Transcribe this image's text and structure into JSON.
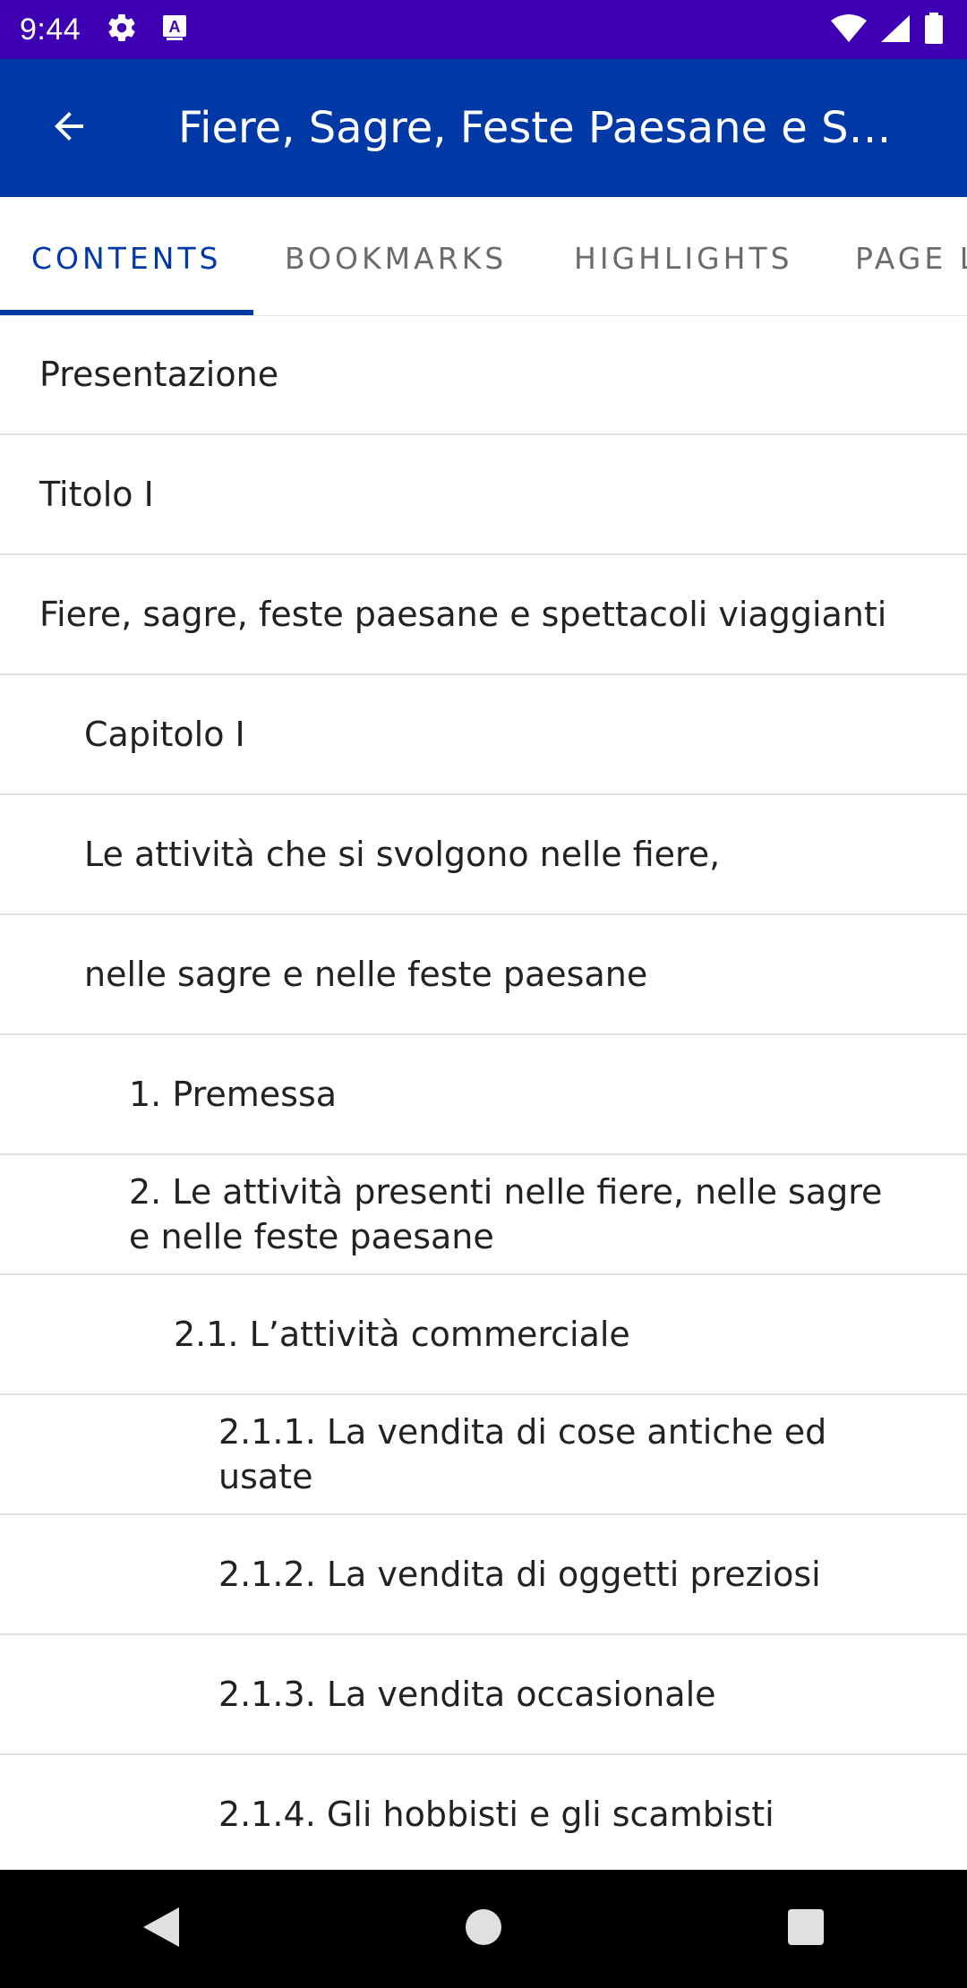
{
  "status_bar": {
    "time": "9:44",
    "icons": [
      "settings-icon",
      "accessibility-a-icon",
      "wifi-icon",
      "signal-icon",
      "battery-icon"
    ],
    "background_color": "#3f00b3"
  },
  "app_bar": {
    "title": "Fiere, Sagre, Feste Paesane e S…",
    "back_icon": "arrow-back-icon",
    "background_color": "#0039a6"
  },
  "tabs": [
    {
      "label": "CONTENTS",
      "active": true
    },
    {
      "label": "BOOKMARKS",
      "active": false
    },
    {
      "label": "HIGHLIGHTS",
      "active": false
    },
    {
      "label": "PAGE L",
      "active": false
    }
  ],
  "toc": [
    {
      "label": "Presentazione",
      "level": 0
    },
    {
      "label": "Titolo I",
      "level": 0
    },
    {
      "label": "Fiere, sagre, feste paesane e spettacoli viaggianti",
      "level": 0
    },
    {
      "label": "Capitolo I",
      "level": 1
    },
    {
      "label": "Le attività che si svolgono nelle fiere,",
      "level": 1
    },
    {
      "label": "nelle sagre e nelle feste paesane",
      "level": 1
    },
    {
      "label": "1. Premessa",
      "level": 2
    },
    {
      "label": "2. Le attività presenti nelle fiere, nelle sagre e nelle feste paesane",
      "level": 2
    },
    {
      "label": "2.1. L’attività commerciale",
      "level": 3
    },
    {
      "label": "2.1.1. La vendita di cose antiche ed usate",
      "level": 4
    },
    {
      "label": "2.1.2. La vendita di oggetti preziosi",
      "level": 4
    },
    {
      "label": "2.1.3. La vendita occasionale",
      "level": 4
    },
    {
      "label": "2.1.4. Gli hobbisti e gli scambisti",
      "level": 4
    }
  ],
  "nav_bar": {
    "buttons": [
      "back-triangle-icon",
      "home-circle-icon",
      "recents-square-icon"
    ]
  }
}
